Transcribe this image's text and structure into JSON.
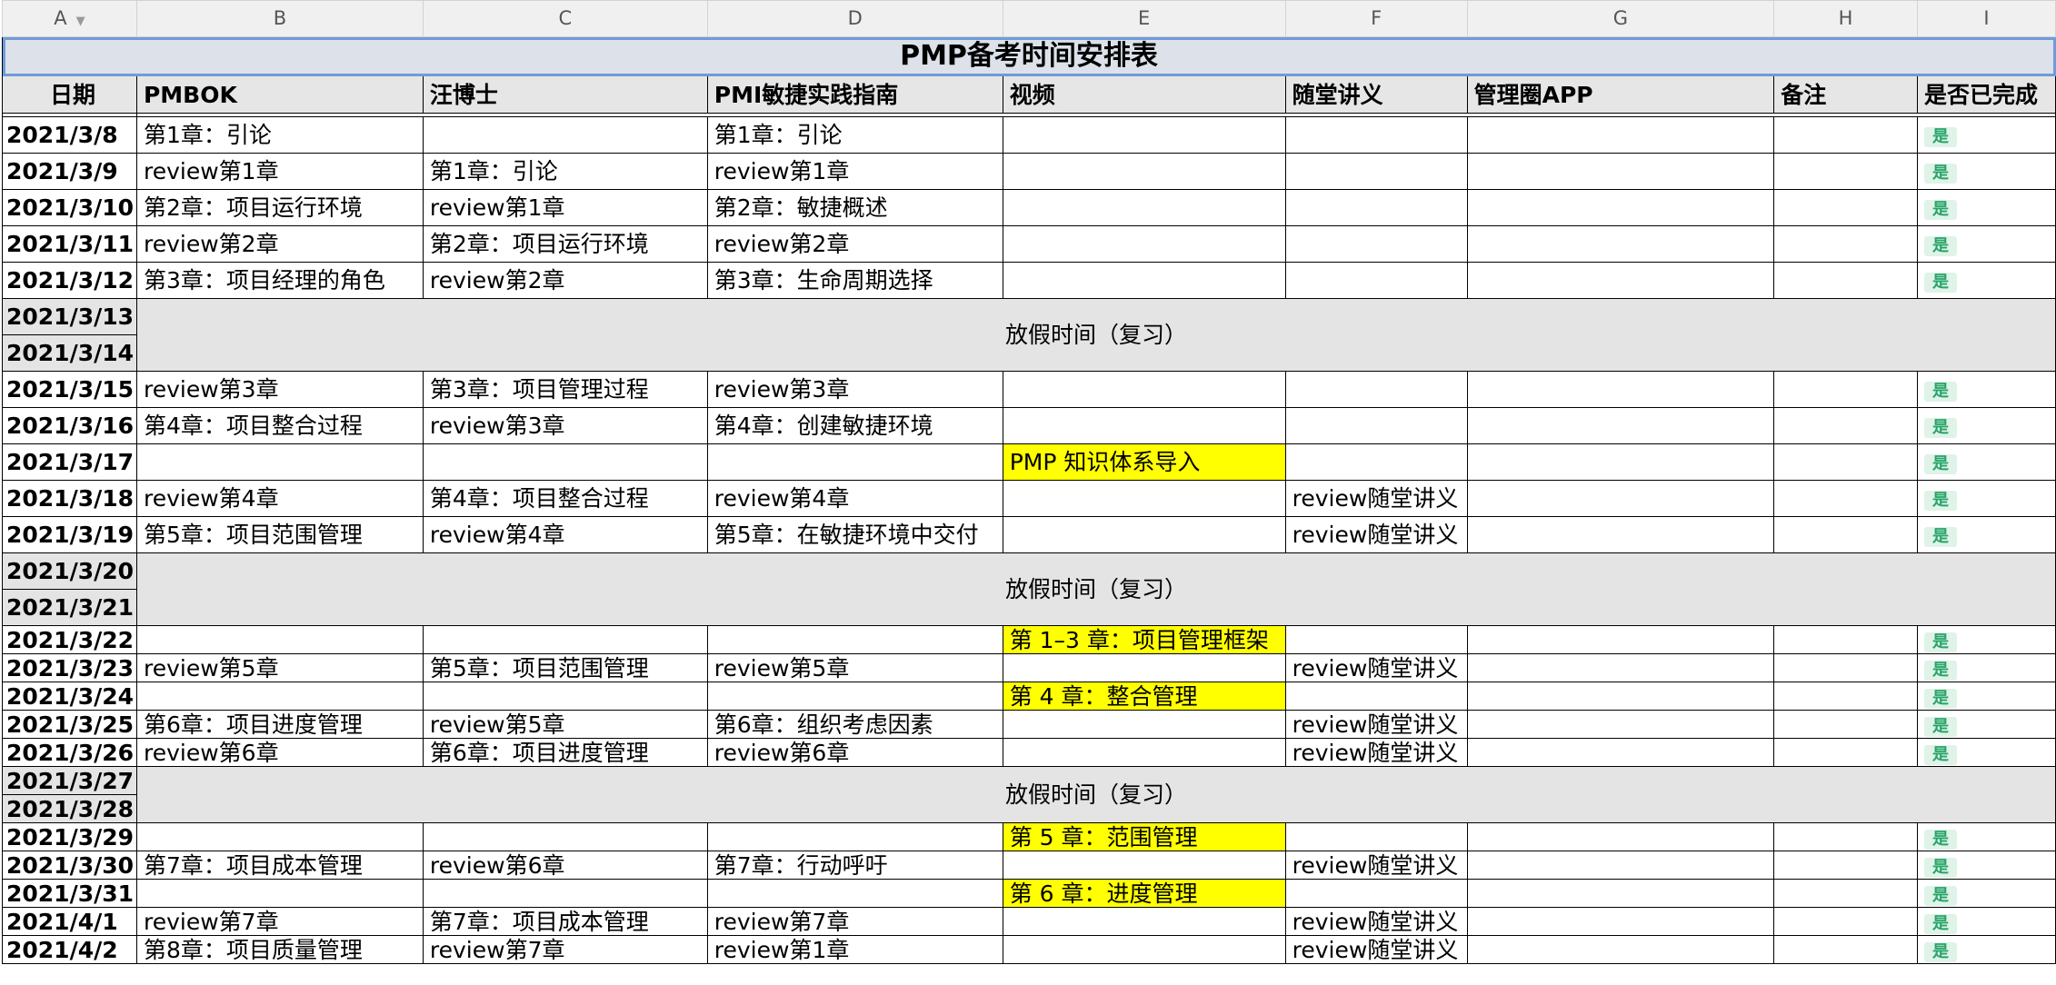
{
  "columns": [
    "A",
    "B",
    "C",
    "D",
    "E",
    "F",
    "G",
    "H",
    "I"
  ],
  "title": "PMP备考时间安排表",
  "headers": {
    "date": "日期",
    "pmbok": "PMBOK",
    "wang": "汪博士",
    "agile": "PMI敏捷实践指南",
    "video": "视频",
    "notes": "随堂讲义",
    "app": "管理圈APP",
    "remark": "备注",
    "done": "是否已完成"
  },
  "holiday_label": "放假时间（复习）",
  "done_label": "是",
  "rows": [
    {
      "date": "2021/3/8",
      "pmbok": "第1章：引论",
      "wang": "",
      "agile": "第1章：引论",
      "video": "",
      "notes": "",
      "done": "是"
    },
    {
      "date": "2021/3/9",
      "pmbok": "review第1章",
      "wang": "第1章：引论",
      "agile": "review第1章",
      "video": "",
      "notes": "",
      "done": "是"
    },
    {
      "date": "2021/3/10",
      "pmbok": "第2章：项目运行环境",
      "wang": "review第1章",
      "agile": "第2章：敏捷概述",
      "video": "",
      "notes": "",
      "done": "是"
    },
    {
      "date": "2021/3/11",
      "pmbok": "review第2章",
      "wang": "第2章：项目运行环境",
      "agile": "review第2章",
      "video": "",
      "notes": "",
      "done": "是"
    },
    {
      "date": "2021/3/12",
      "pmbok": "第3章：项目经理的角色",
      "wang": "review第2章",
      "agile": "第3章：生命周期选择",
      "video": "",
      "notes": "",
      "done": "是"
    },
    {
      "date": "2021/3/13",
      "holiday": true
    },
    {
      "date": "2021/3/14",
      "holiday": true
    },
    {
      "date": "2021/3/15",
      "pmbok": "review第3章",
      "wang": "第3章：项目管理过程",
      "agile": "review第3章",
      "video": "",
      "notes": "",
      "done": "是"
    },
    {
      "date": "2021/3/16",
      "pmbok": "第4章：项目整合过程",
      "wang": "review第3章",
      "agile": "第4章：创建敏捷环境",
      "video": "",
      "notes": "",
      "done": "是"
    },
    {
      "date": "2021/3/17",
      "pmbok": "",
      "wang": "",
      "agile": "",
      "video": "PMP 知识体系导入",
      "notes": "",
      "done": "是"
    },
    {
      "date": "2021/3/18",
      "pmbok": "review第4章",
      "wang": "第4章：项目整合过程",
      "agile": "review第4章",
      "video": "",
      "notes": "review随堂讲义",
      "done": "是"
    },
    {
      "date": "2021/3/19",
      "pmbok": "第5章：项目范围管理",
      "wang": "review第4章",
      "agile": "第5章：在敏捷环境中交付",
      "video": "",
      "notes": "review随堂讲义",
      "done": "是"
    },
    {
      "date": "2021/3/20",
      "holiday": true
    },
    {
      "date": "2021/3/21",
      "holiday": true
    },
    {
      "date": "2021/3/22",
      "pmbok": "",
      "wang": "",
      "agile": "",
      "video": "第 1–3 章：项目管理框架",
      "notes": "",
      "done": "是"
    },
    {
      "date": "2021/3/23",
      "pmbok": "review第5章",
      "wang": "第5章：项目范围管理",
      "agile": "review第5章",
      "video": "",
      "notes": "review随堂讲义",
      "done": "是"
    },
    {
      "date": "2021/3/24",
      "pmbok": "",
      "wang": "",
      "agile": "",
      "video": "第 4 章：整合管理",
      "notes": "",
      "done": "是"
    },
    {
      "date": "2021/3/25",
      "pmbok": "第6章：项目进度管理",
      "wang": "review第5章",
      "agile": "第6章：组织考虑因素",
      "video": "",
      "notes": "review随堂讲义",
      "done": "是"
    },
    {
      "date": "2021/3/26",
      "pmbok": "review第6章",
      "wang": "第6章：项目进度管理",
      "agile": "review第6章",
      "video": "",
      "notes": "review随堂讲义",
      "done": "是"
    },
    {
      "date": "2021/3/27",
      "holiday": true
    },
    {
      "date": "2021/3/28",
      "holiday": true
    },
    {
      "date": "2021/3/29",
      "pmbok": "",
      "wang": "",
      "agile": "",
      "video": "第 5 章：范围管理",
      "notes": "",
      "done": "是"
    },
    {
      "date": "2021/3/30",
      "pmbok": "第7章：项目成本管理",
      "wang": "review第6章",
      "agile": "第7章：行动呼吁",
      "video": "",
      "notes": "review随堂讲义",
      "done": "是"
    },
    {
      "date": "2021/3/31",
      "pmbok": "",
      "wang": "",
      "agile": "",
      "video": "第 6 章：进度管理",
      "notes": "",
      "done": "是"
    },
    {
      "date": "2021/4/1",
      "pmbok": "review第7章",
      "wang": "第7章：项目成本管理",
      "agile": "review第7章",
      "video": "",
      "notes": "review随堂讲义",
      "done": "是"
    },
    {
      "date": "2021/4/2",
      "pmbok": "第8章：项目质量管理",
      "wang": "review第7章",
      "agile": "review第1章",
      "video": "",
      "notes": "review随堂讲义",
      "done": "是"
    }
  ]
}
